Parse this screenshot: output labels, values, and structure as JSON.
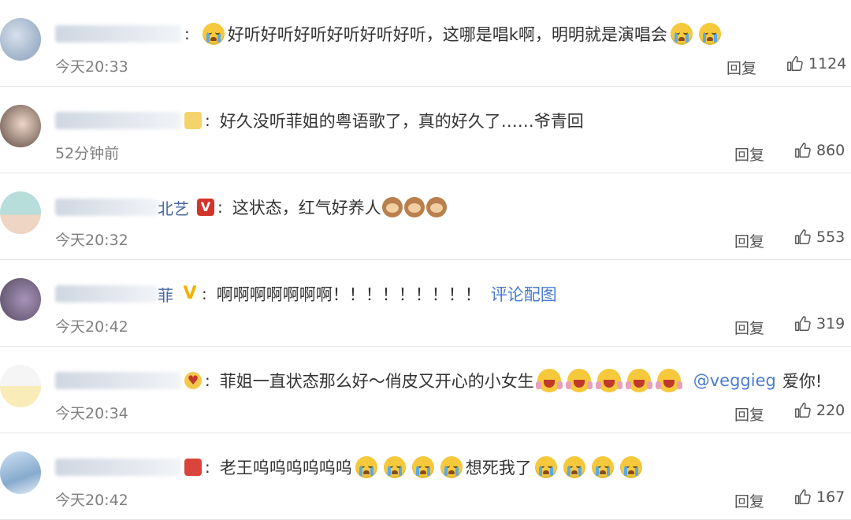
{
  "comments": [
    {
      "name_visible": "",
      "badge": "",
      "segments": [
        {
          "kind": "emo"
        },
        {
          "kind": "text",
          "value": "好听好听好听好听好听好听，这哪是唱k啊，明明就是演唱会"
        },
        {
          "kind": "emo"
        },
        {
          "kind": "emo"
        }
      ],
      "time": "今天20:33",
      "reply_label": "回复",
      "likes": "1124"
    },
    {
      "name_visible": "",
      "badge": "crown",
      "segments": [
        {
          "kind": "text",
          "value": "好久没听菲姐的粤语歌了，真的好久了……爷青回"
        }
      ],
      "time": "52分钟前",
      "reply_label": "回复",
      "likes": "860"
    },
    {
      "name_visible": "北艺",
      "badge": "v-red",
      "segments": [
        {
          "kind": "text",
          "value": "这状态，红气好养人"
        },
        {
          "kind": "monkey"
        },
        {
          "kind": "monkey"
        },
        {
          "kind": "monkey"
        }
      ],
      "time": "今天20:32",
      "reply_label": "回复",
      "likes": "553"
    },
    {
      "name_visible": "菲",
      "badge": "v",
      "segments": [
        {
          "kind": "text",
          "value": "啊啊啊啊啊啊啊！！！！！！！！！"
        },
        {
          "kind": "link",
          "value": "评论配图"
        }
      ],
      "time": "今天20:42",
      "reply_label": "回复",
      "likes": "319"
    },
    {
      "name_visible": "",
      "badge": "face",
      "segments": [
        {
          "kind": "text",
          "value": "菲姐一直状态那么好～俏皮又开心的小女生"
        },
        {
          "kind": "laugh"
        },
        {
          "kind": "laugh"
        },
        {
          "kind": "laugh"
        },
        {
          "kind": "laugh"
        },
        {
          "kind": "laugh"
        },
        {
          "kind": "link",
          "value": "@veggieg"
        },
        {
          "kind": "text",
          "value": "爱你!"
        }
      ],
      "time": "今天20:34",
      "reply_label": "回复",
      "likes": "220"
    },
    {
      "name_visible": "",
      "badge": "tag",
      "segments": [
        {
          "kind": "text",
          "value": "老王呜呜呜呜呜呜"
        },
        {
          "kind": "emo"
        },
        {
          "kind": "emo"
        },
        {
          "kind": "emo"
        },
        {
          "kind": "emo"
        },
        {
          "kind": "text",
          "value": "想死我了"
        },
        {
          "kind": "emo"
        },
        {
          "kind": "emo"
        },
        {
          "kind": "emo"
        },
        {
          "kind": "emo"
        }
      ],
      "time": "今天20:42",
      "reply_label": "回复",
      "likes": "167"
    }
  ],
  "icons": {
    "like": "thumbs-up-icon",
    "crying": "loudly-crying-face-icon",
    "monkey": "see-no-evil-monkey-icon",
    "laughing": "laughing-face-icon"
  }
}
